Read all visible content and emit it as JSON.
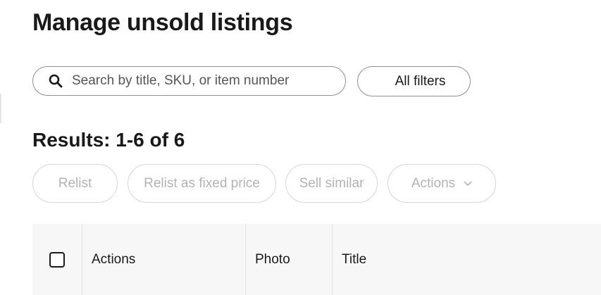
{
  "page": {
    "title": "Manage unsold listings"
  },
  "search": {
    "placeholder": "Search by title, SKU, or item number",
    "icon": "search-icon"
  },
  "filters": {
    "label": "All filters"
  },
  "results": {
    "heading": "Results: 1-6 of 6"
  },
  "toolbar": {
    "relist_label": "Relist",
    "relist_fixed_label": "Relist as fixed price",
    "sell_similar_label": "Sell similar",
    "actions_label": "Actions",
    "disabled_color": "#b3b3b3"
  },
  "table": {
    "columns": [
      {
        "label": ""
      },
      {
        "label": "Actions"
      },
      {
        "label": "Photo"
      },
      {
        "label": "Title"
      }
    ],
    "header_background": "#f7f7f7"
  }
}
